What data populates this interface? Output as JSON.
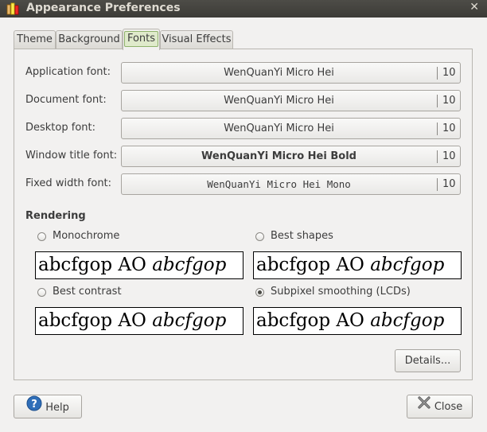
{
  "window": {
    "title": "Appearance Preferences"
  },
  "tabs": [
    "Theme",
    "Background",
    "Fonts",
    "Visual Effects"
  ],
  "fonts": [
    {
      "label": "Application font:",
      "font": "WenQuanYi Micro Hei",
      "size": "10"
    },
    {
      "label": "Document font:",
      "font": "WenQuanYi Micro Hei",
      "size": "10"
    },
    {
      "label": "Desktop font:",
      "font": "WenQuanYi Micro Hei",
      "size": "10"
    },
    {
      "label": "Window title font:",
      "font": "WenQuanYi Micro Hei Bold",
      "size": "10"
    },
    {
      "label": "Fixed width font:",
      "font": "WenQuanYi Micro Hei Mono",
      "size": "10"
    }
  ],
  "rendering": {
    "title": "Rendering",
    "options": [
      {
        "label": "Monochrome",
        "checked": false
      },
      {
        "label": "Best shapes",
        "checked": false
      },
      {
        "label": "Best contrast",
        "checked": false
      },
      {
        "label": "Subpixel smoothing (LCDs)",
        "checked": true
      }
    ],
    "sample_regular": "abcfgop AO ",
    "sample_italic": "abcfgop"
  },
  "buttons": {
    "details": "Details...",
    "help": "Help",
    "close": "Close"
  },
  "icons": {
    "app": "appearance-icon",
    "help": "help-icon",
    "close": "close-icon"
  },
  "colors": {
    "titlebar": "#3c3b37",
    "window_bg": "#f2f1f0",
    "active_tab": "#dfeacb",
    "help_icon": "#2f6eb8"
  }
}
